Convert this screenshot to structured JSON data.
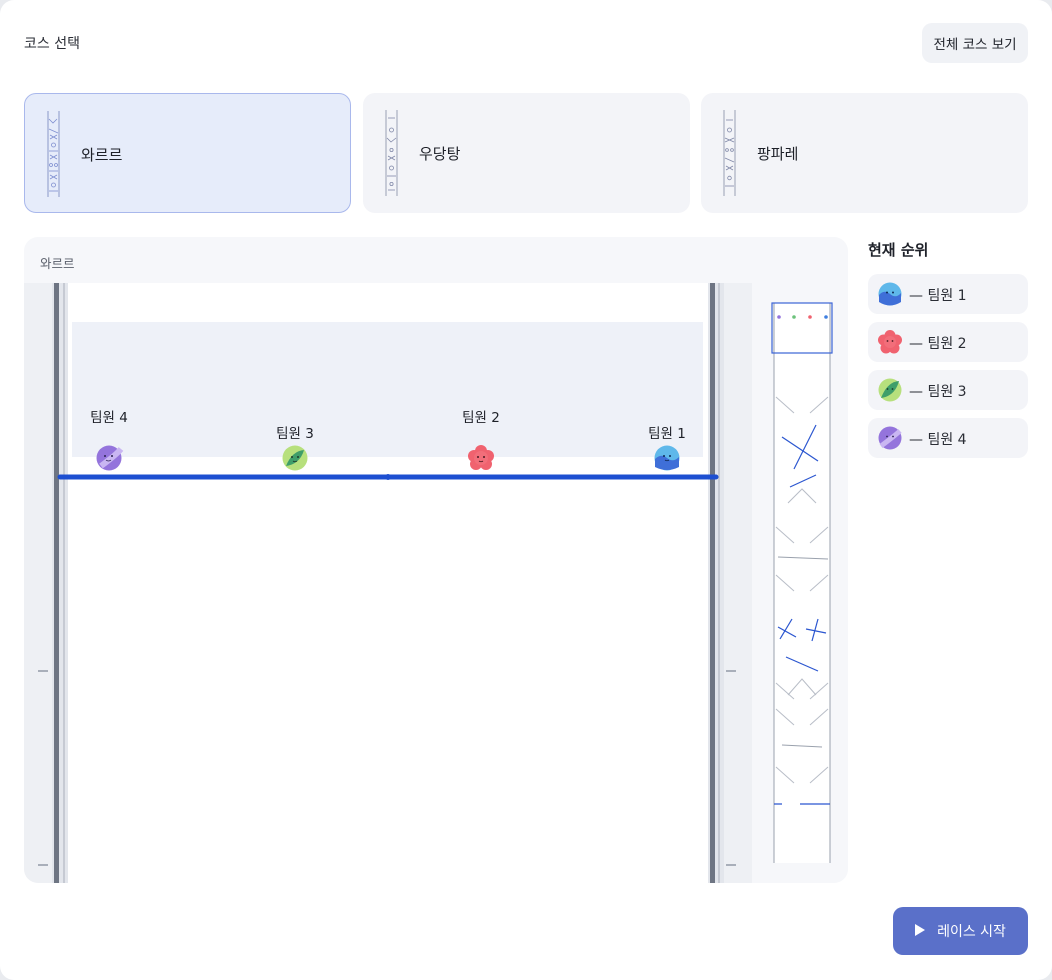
{
  "header": {
    "label": "코스 선택",
    "view_all_label": "전체 코스 보기"
  },
  "courses": [
    {
      "name": "와르르",
      "selected": true
    },
    {
      "name": "우당탕",
      "selected": false
    },
    {
      "name": "팡파레",
      "selected": false
    }
  ],
  "stage": {
    "title": "와르르",
    "players": [
      {
        "label": "팀원 1",
        "color": "#3f7fe0",
        "icon": "blue-wave-marble-icon"
      },
      {
        "label": "팀원 2",
        "color": "#f0626f",
        "icon": "pink-flower-marble-icon"
      },
      {
        "label": "팀원 3",
        "color": "#6cc27b",
        "icon": "green-leaf-marble-icon"
      },
      {
        "label": "팀원 4",
        "color": "#9474dc",
        "icon": "purple-marble-icon"
      }
    ]
  },
  "ranking": {
    "title": "현재 순위",
    "items": [
      {
        "text": "— 팀원 1",
        "color": "#3f7fe0"
      },
      {
        "text": "— 팀원 2",
        "color": "#f0626f"
      },
      {
        "text": "— 팀원 3",
        "color": "#6cc27b"
      },
      {
        "text": "— 팀원 4",
        "color": "#9474dc"
      }
    ]
  },
  "actions": {
    "start_label": "레이스 시작"
  }
}
